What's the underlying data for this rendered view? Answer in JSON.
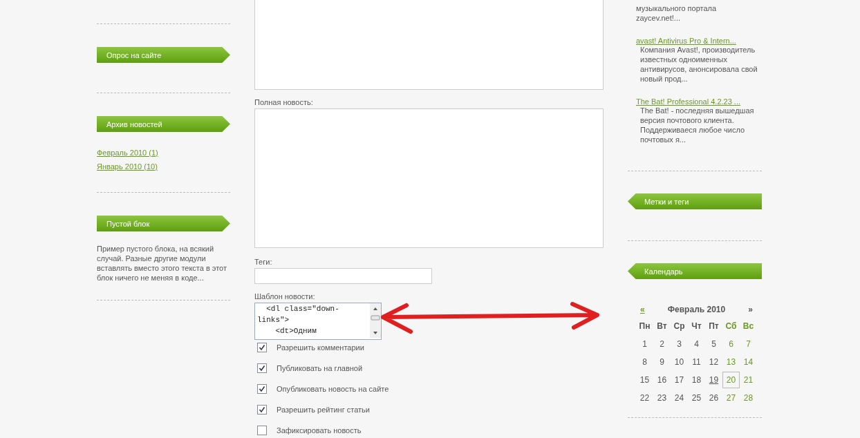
{
  "left_sidebar": {
    "blocks": [
      {
        "title": "Опрос на сайте"
      },
      {
        "title": "Архив новостей",
        "links": [
          "Февраль 2010 (1)",
          "Январь 2010 (10)"
        ]
      },
      {
        "title": "Пустой блок",
        "text": "Пример пустого блока, на всякий случай. Разные другие модули вставлять вместо этого текста в этот блок ничего не меняя в коде..."
      }
    ]
  },
  "form": {
    "full_news": {
      "label": "Полная новость:"
    },
    "tags": {
      "label": "Теги:"
    },
    "template": {
      "label": "Шаблон новости:",
      "value": "  <dl class=\"down-links\">\n    <dt>Одним "
    },
    "options": [
      {
        "label": "Разрешить комментарии",
        "checked": true
      },
      {
        "label": "Публиковать на главной",
        "checked": true
      },
      {
        "label": "Опубликовать новость на сайте",
        "checked": true
      },
      {
        "label": "Разрешить рейтинг статьи",
        "checked": true
      },
      {
        "label": "Зафиксировать новость",
        "checked": false
      }
    ]
  },
  "right_sidebar": {
    "news_tail": "музыкального портала zaycev.net!...",
    "news": [
      {
        "title": "avast! Antivirus Pro & Intern...",
        "text": "Компания Avast!, производитель известных одноименных антивирусов, анонсировала свой новый прод..."
      },
      {
        "title": "The Bat! Professional 4.2.23 ...",
        "text": "The Bat! - последняя вышедшая версия почтового клиента. Поддерживаеся любое число почтовых я..."
      }
    ],
    "tags_title": "Метки и теги",
    "calendar": {
      "title": "Календарь",
      "prev": "«",
      "month": "Февраль 2010",
      "next": "»",
      "weekdays": [
        "Пн",
        "Вт",
        "Ср",
        "Чт",
        "Пт",
        "Сб",
        "Вс"
      ],
      "weeks": [
        [
          {
            "d": "1",
            "link": false,
            "selected": false
          },
          {
            "d": "2",
            "link": false,
            "selected": false
          },
          {
            "d": "3",
            "link": false,
            "selected": false
          },
          {
            "d": "4",
            "link": false,
            "selected": false
          },
          {
            "d": "5",
            "link": false,
            "selected": false
          },
          {
            "d": "6",
            "link": false,
            "selected": false
          },
          {
            "d": "7",
            "link": false,
            "selected": false
          }
        ],
        [
          {
            "d": "8",
            "link": false,
            "selected": false
          },
          {
            "d": "9",
            "link": false,
            "selected": false
          },
          {
            "d": "10",
            "link": false,
            "selected": false
          },
          {
            "d": "11",
            "link": false,
            "selected": false
          },
          {
            "d": "12",
            "link": false,
            "selected": false
          },
          {
            "d": "13",
            "link": false,
            "selected": false
          },
          {
            "d": "14",
            "link": false,
            "selected": false
          }
        ],
        [
          {
            "d": "15",
            "link": false,
            "selected": false
          },
          {
            "d": "16",
            "link": false,
            "selected": false
          },
          {
            "d": "17",
            "link": false,
            "selected": false
          },
          {
            "d": "18",
            "link": false,
            "selected": false
          },
          {
            "d": "19",
            "link": true,
            "selected": false
          },
          {
            "d": "20",
            "link": false,
            "selected": true
          },
          {
            "d": "21",
            "link": false,
            "selected": false
          }
        ],
        [
          {
            "d": "22",
            "link": false,
            "selected": false
          },
          {
            "d": "23",
            "link": false,
            "selected": false
          },
          {
            "d": "24",
            "link": false,
            "selected": false
          },
          {
            "d": "25",
            "link": false,
            "selected": false
          },
          {
            "d": "26",
            "link": false,
            "selected": false
          },
          {
            "d": "27",
            "link": false,
            "selected": false
          },
          {
            "d": "28",
            "link": false,
            "selected": false
          }
        ]
      ]
    }
  }
}
